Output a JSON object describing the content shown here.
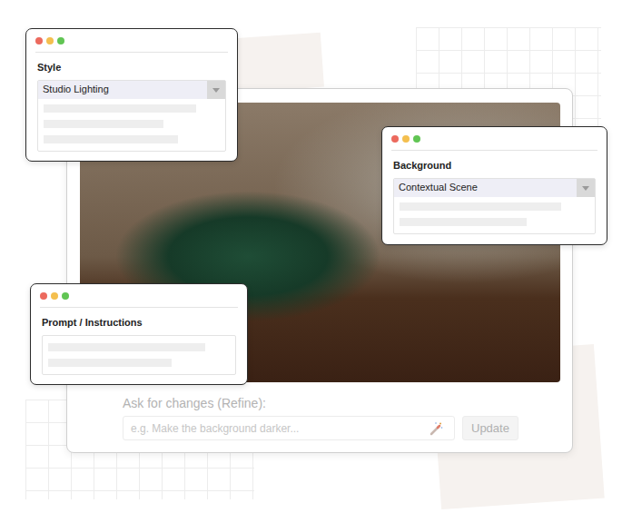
{
  "panels": [
    {
      "title": "Style",
      "value": "Studio Lighting",
      "kind": "select"
    },
    {
      "title": "Background",
      "value": "Contextual Scene",
      "kind": "select"
    },
    {
      "title": "Prompt / Instructions",
      "value": "",
      "kind": "textarea"
    }
  ],
  "refine": {
    "label": "Ask for changes (Refine):",
    "placeholder": "e.g. Make the background darker...",
    "button": "Update",
    "disabled": true
  }
}
